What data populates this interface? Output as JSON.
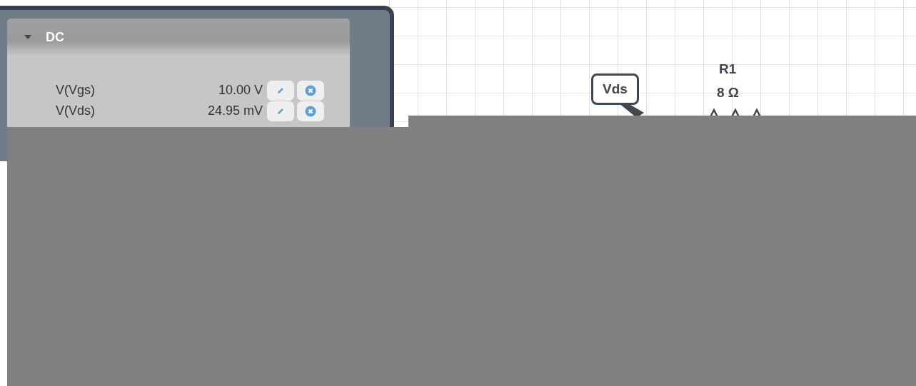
{
  "panel": {
    "section": {
      "title": "DC",
      "expanded": true,
      "rows": [
        {
          "label": "V(Vgs)",
          "value": "10.00 V"
        },
        {
          "label": "V(Vds)",
          "value": "24.95 mV"
        }
      ]
    }
  },
  "canvas": {
    "probe": {
      "label": "Vds"
    },
    "resistor": {
      "name": "R1",
      "value": "8 Ω"
    }
  }
}
